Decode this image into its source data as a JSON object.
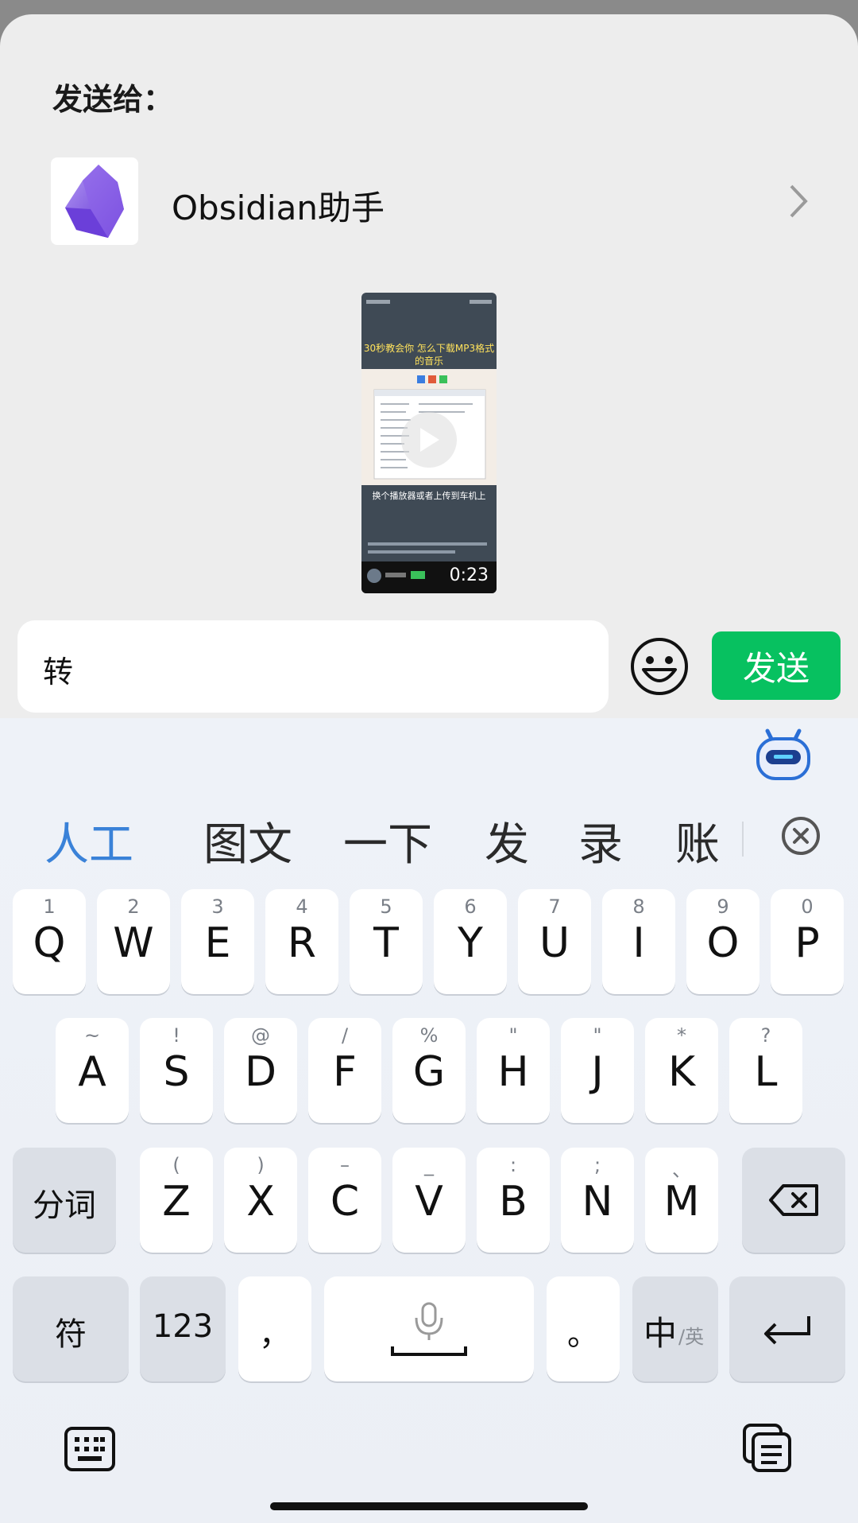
{
  "share_sheet": {
    "title": "发送给：",
    "contact": {
      "name": "Obsidian助手"
    },
    "video": {
      "caption_top": "30秒教会你 怎么下载MP3格式的音乐",
      "caption_bottom": "换个播放器或者上传到车机上",
      "duration": "0:23"
    },
    "message": {
      "value": "转"
    },
    "send_label": "发送"
  },
  "keyboard": {
    "candidates": [
      "人工",
      "图文",
      "一下",
      "发",
      "录",
      "账"
    ],
    "row1": [
      {
        "label": "Q",
        "sub": "1"
      },
      {
        "label": "W",
        "sub": "2"
      },
      {
        "label": "E",
        "sub": "3"
      },
      {
        "label": "R",
        "sub": "4"
      },
      {
        "label": "T",
        "sub": "5"
      },
      {
        "label": "Y",
        "sub": "6"
      },
      {
        "label": "U",
        "sub": "7"
      },
      {
        "label": "I",
        "sub": "8"
      },
      {
        "label": "O",
        "sub": "9"
      },
      {
        "label": "P",
        "sub": "0"
      }
    ],
    "row2": [
      {
        "label": "A",
        "sub": "~"
      },
      {
        "label": "S",
        "sub": "!"
      },
      {
        "label": "D",
        "sub": "@"
      },
      {
        "label": "F",
        "sub": "/"
      },
      {
        "label": "G",
        "sub": "%"
      },
      {
        "label": "H",
        "sub": "\""
      },
      {
        "label": "J",
        "sub": "\""
      },
      {
        "label": "K",
        "sub": "*"
      },
      {
        "label": "L",
        "sub": "?"
      }
    ],
    "row3": [
      {
        "label": "Z",
        "sub": "("
      },
      {
        "label": "X",
        "sub": ")"
      },
      {
        "label": "C",
        "sub": "–"
      },
      {
        "label": "V",
        "sub": "_"
      },
      {
        "label": "B",
        "sub": ":"
      },
      {
        "label": "N",
        "sub": ";"
      },
      {
        "label": "M",
        "sub": "、"
      }
    ],
    "segment_label": "分词",
    "symbol_label": "符",
    "numbers_label": "123",
    "comma_label": "，",
    "period_label": "。",
    "lang_main": "中",
    "lang_alt": "/英"
  }
}
